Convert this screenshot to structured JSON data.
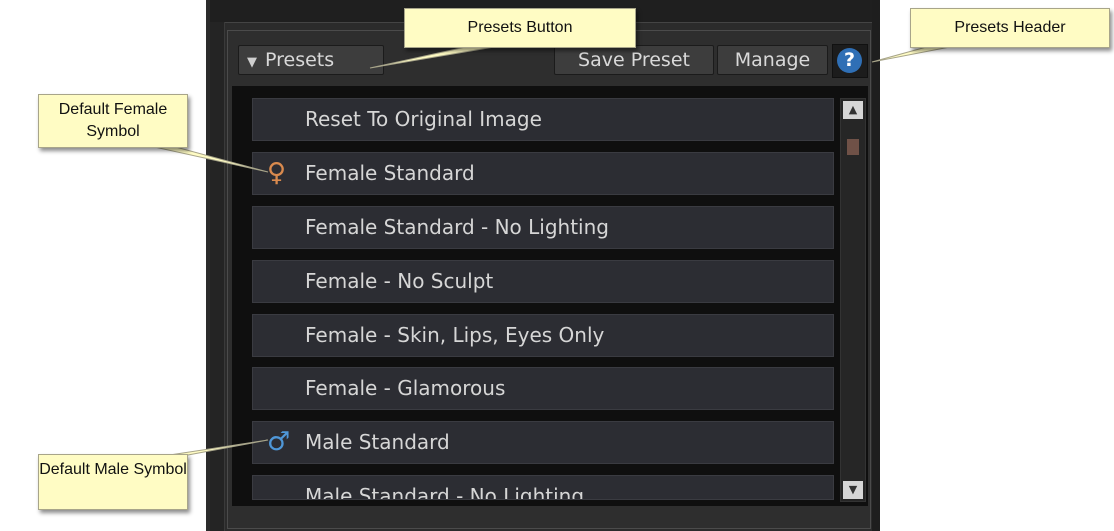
{
  "callouts": {
    "presets_button": "Presets Button",
    "presets_header": "Presets Header",
    "default_female": "Default Female Symbol",
    "default_male": "Default Male Symbol"
  },
  "toolbar": {
    "presets_label": "Presets",
    "save_preset_label": "Save Preset",
    "manage_label": "Manage",
    "help_label": "?"
  },
  "presets": [
    {
      "label": "Reset To Original Image",
      "symbol": ""
    },
    {
      "label": "Female Standard",
      "symbol": "♀"
    },
    {
      "label": "Female Standard - No Lighting",
      "symbol": ""
    },
    {
      "label": "Female - No Sculpt",
      "symbol": ""
    },
    {
      "label": "Female - Skin, Lips, Eyes Only",
      "symbol": ""
    },
    {
      "label": "Female - Glamorous",
      "symbol": ""
    },
    {
      "label": "Male Standard",
      "symbol": "♂"
    },
    {
      "label": "Male Standard - No Lighting",
      "symbol": ""
    }
  ],
  "colors": {
    "female_symbol": "#d98a4e",
    "male_symbol": "#4f97d8",
    "callout_bg": "#fffcc4"
  }
}
